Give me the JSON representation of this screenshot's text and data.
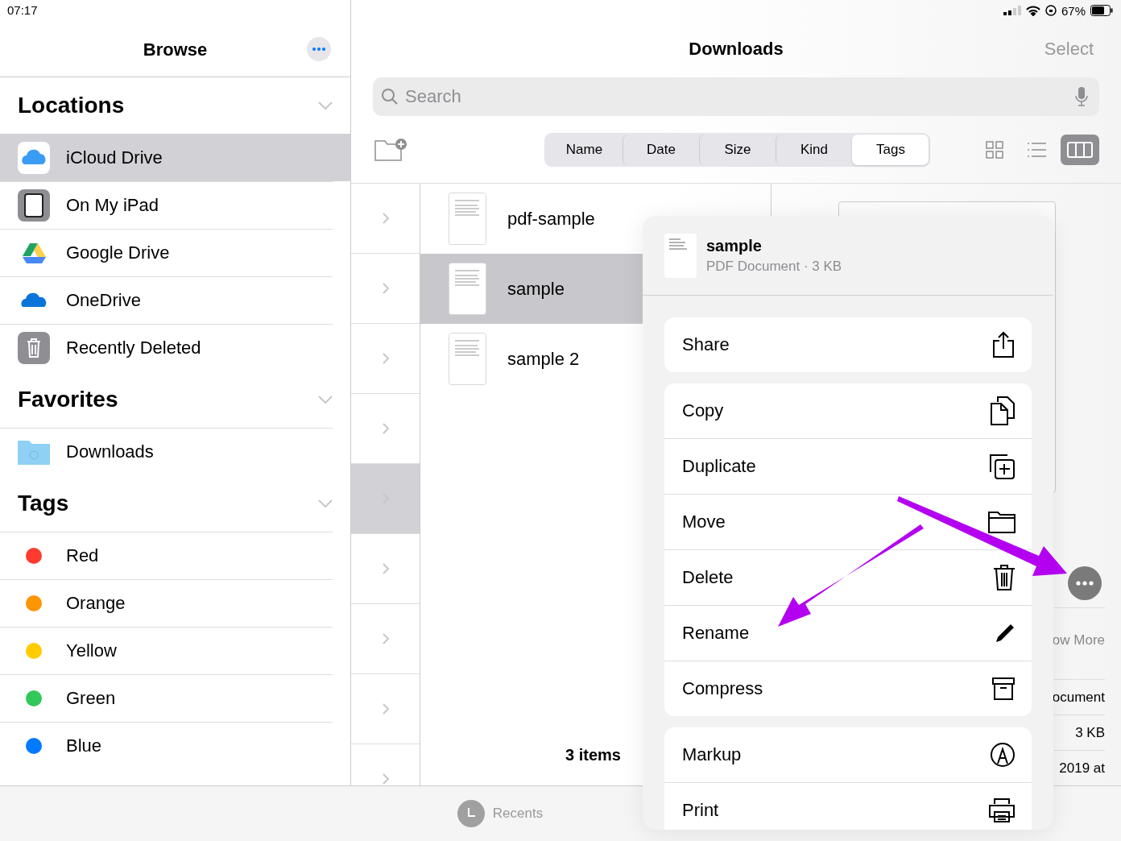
{
  "status_bar": {
    "time": "07:17",
    "battery": "67%"
  },
  "sidebar": {
    "title": "Browse",
    "sections": [
      {
        "title": "Locations",
        "expanded": true,
        "items": [
          {
            "label": "iCloud Drive",
            "kind": "icloud",
            "selected": true
          },
          {
            "label": "On My iPad",
            "kind": "ipad",
            "selected": false
          },
          {
            "label": "Google Drive",
            "kind": "gdrive",
            "selected": false
          },
          {
            "label": "OneDrive",
            "kind": "onedrive",
            "selected": false
          },
          {
            "label": "Recently Deleted",
            "kind": "trash",
            "selected": false
          }
        ]
      },
      {
        "title": "Favorites",
        "expanded": true,
        "items": [
          {
            "label": "Downloads",
            "kind": "folder",
            "selected": false
          }
        ]
      },
      {
        "title": "Tags",
        "expanded": true,
        "items": [
          {
            "label": "Red",
            "kind": "tag",
            "color": "#ff3b30",
            "selected": false
          },
          {
            "label": "Orange",
            "kind": "tag",
            "color": "#ff9500",
            "selected": false
          },
          {
            "label": "Yellow",
            "kind": "tag",
            "color": "#ffcc00",
            "selected": false
          },
          {
            "label": "Green",
            "kind": "tag",
            "color": "#34c759",
            "selected": false
          },
          {
            "label": "Blue",
            "kind": "tag",
            "color": "#007aff",
            "selected": false
          }
        ]
      }
    ]
  },
  "main": {
    "title": "Downloads",
    "select": "Select",
    "search": {
      "placeholder": "Search"
    },
    "sort_tabs": [
      {
        "label": "Name",
        "selected": false
      },
      {
        "label": "Date",
        "selected": false
      },
      {
        "label": "Size",
        "selected": false
      },
      {
        "label": "Kind",
        "selected": false
      },
      {
        "label": "Tags",
        "selected": true
      }
    ],
    "views": [
      {
        "kind": "grid",
        "selected": false
      },
      {
        "kind": "list",
        "selected": false
      },
      {
        "kind": "columns",
        "selected": true
      }
    ],
    "column_rows": [
      {
        "selected": false
      },
      {
        "selected": false
      },
      {
        "selected": false
      },
      {
        "selected": false
      },
      {
        "selected": true
      },
      {
        "selected": false
      },
      {
        "selected": false
      },
      {
        "selected": false
      },
      {
        "selected": false
      }
    ],
    "files": [
      {
        "name": "pdf-sample",
        "selected": false
      },
      {
        "name": "sample",
        "selected": true
      },
      {
        "name": "sample 2",
        "selected": false
      }
    ],
    "count": "3 items",
    "info": {
      "show_more": "ow More",
      "rows": [
        "ocument",
        "3 KB",
        "2019 at"
      ]
    }
  },
  "menu": {
    "file_name": "sample",
    "file_info": "PDF Document · 3 KB",
    "groups": [
      [
        {
          "label": "Share",
          "kind": "share"
        }
      ],
      [
        {
          "label": "Copy",
          "kind": "copy"
        },
        {
          "label": "Duplicate",
          "kind": "duplicate"
        },
        {
          "label": "Move",
          "kind": "move"
        },
        {
          "label": "Delete",
          "kind": "delete"
        },
        {
          "label": "Rename",
          "kind": "rename"
        },
        {
          "label": "Compress",
          "kind": "compress"
        }
      ],
      [
        {
          "label": "Markup",
          "kind": "markup"
        },
        {
          "label": "Print",
          "kind": "print"
        }
      ]
    ]
  },
  "tab_bar": [
    {
      "label": "Recents",
      "selected": false
    }
  ]
}
